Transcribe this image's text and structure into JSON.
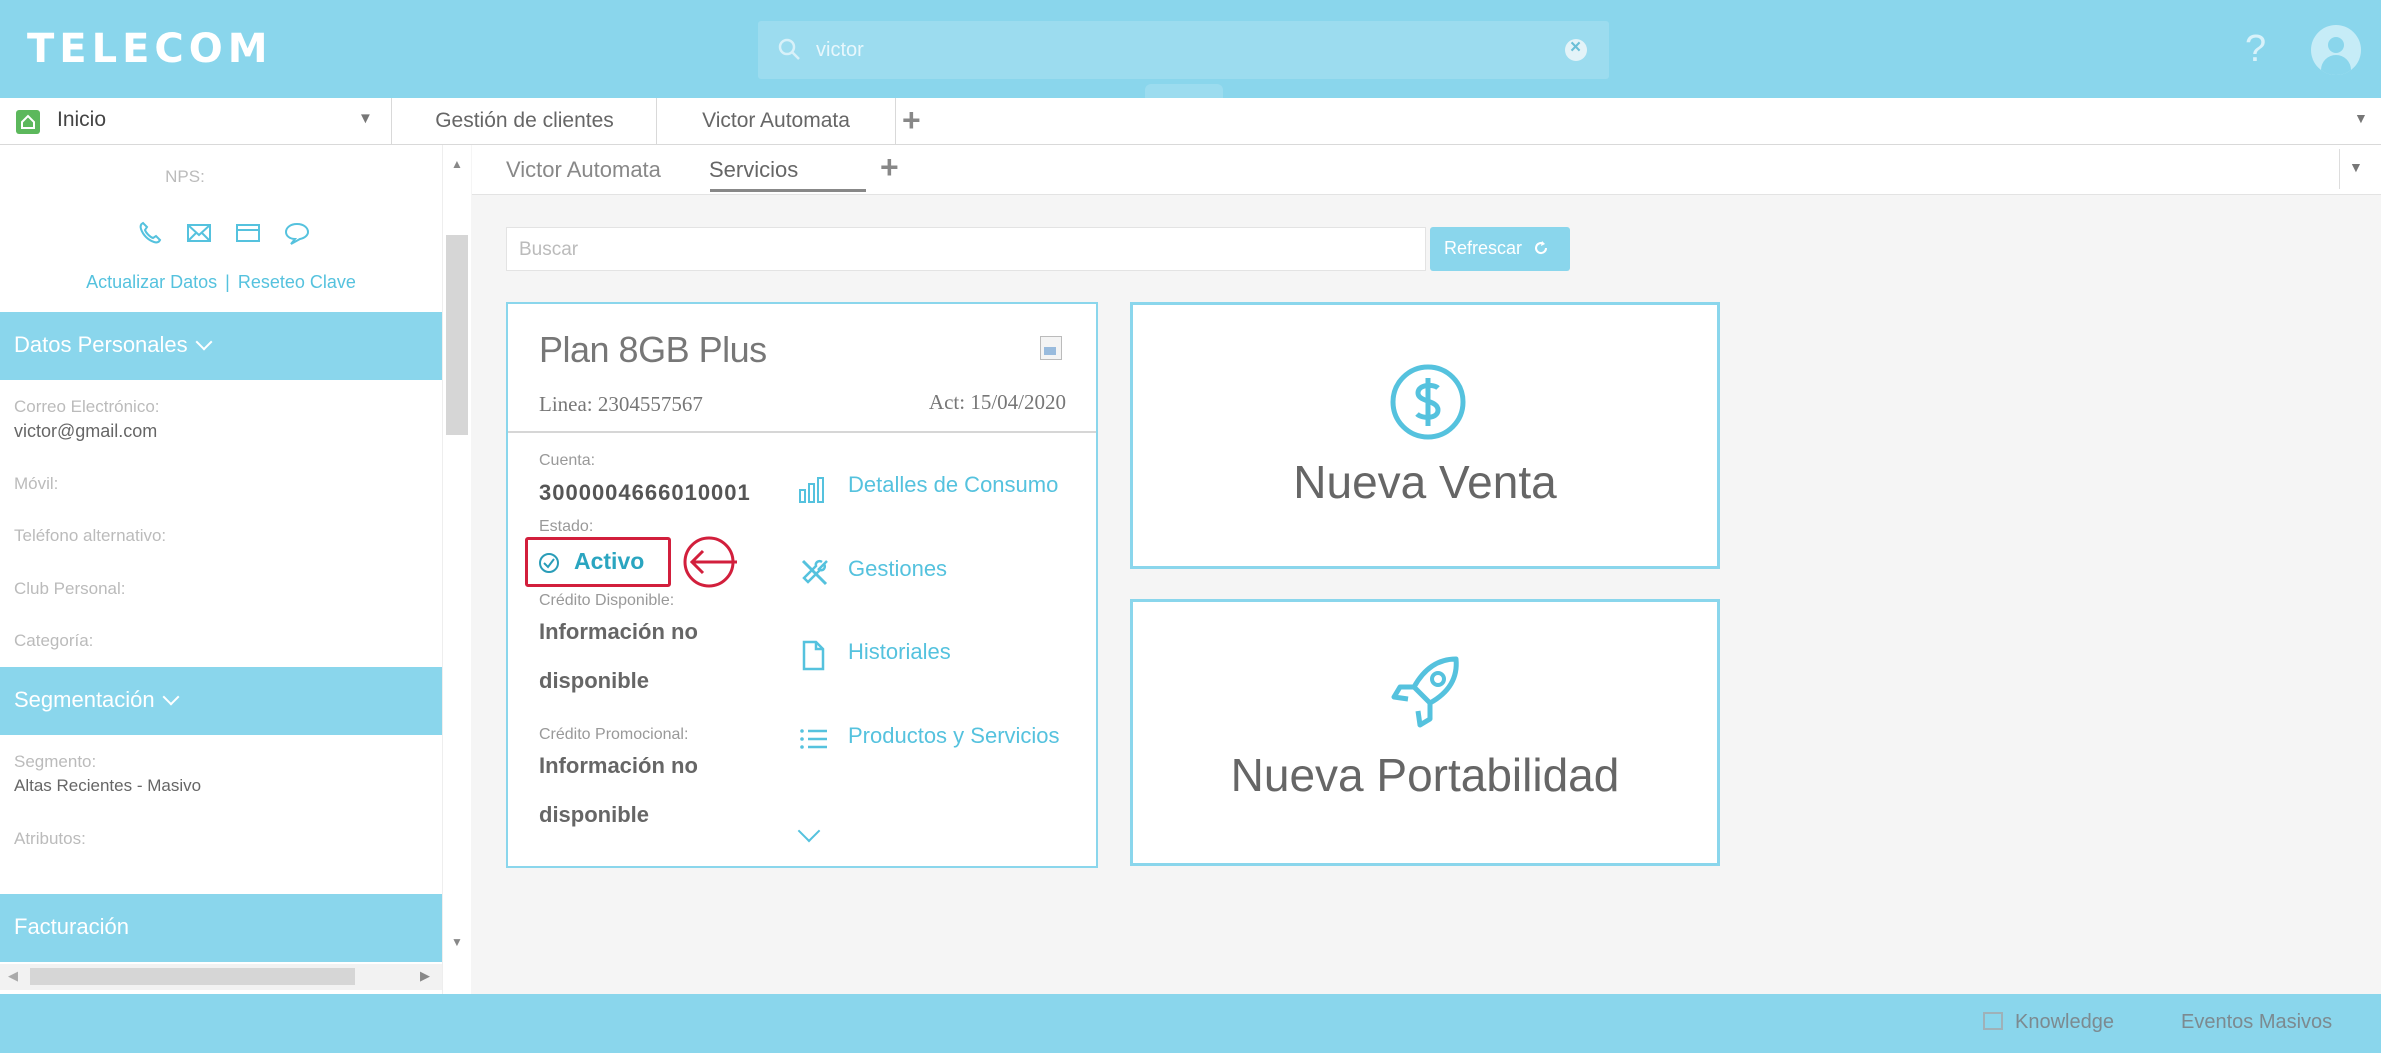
{
  "header": {
    "logo": "TELECOM",
    "search_value": "victor",
    "help_glyph": "?"
  },
  "tabs": {
    "home_label": "Inicio",
    "items": [
      {
        "label": "Gestión de clientes"
      },
      {
        "label": "Victor Automata"
      }
    ],
    "add_glyph": "+"
  },
  "sidebar": {
    "nps_label": "NPS:",
    "link_update": "Actualizar Datos",
    "link_separator": "|",
    "link_reset": "Reseteo Clave",
    "datos_personales": {
      "title": "Datos Personales",
      "correo_label": "Correo Electrónico:",
      "correo_value": "victor@gmail.com",
      "movil_label": "Móvil:",
      "telefono_label": "Teléfono alternativo:",
      "club_label": "Club Personal:",
      "categoria_label": "Categoría:"
    },
    "segmentacion": {
      "title": "Segmentación",
      "segmento_label": "Segmento:",
      "segmento_value": "Altas Recientes - Masivo",
      "atributos_label": "Atributos:"
    },
    "facturacion": {
      "title": "Facturación"
    }
  },
  "subtabs": {
    "items": [
      {
        "label": "Victor Automata"
      },
      {
        "label": "Servicios"
      }
    ],
    "add_glyph": "+"
  },
  "toolbar": {
    "search_placeholder": "Buscar",
    "refresh_label": "Refrescar"
  },
  "plan": {
    "name": "Plan 8GB Plus",
    "linea": "Linea: 2304557567",
    "act": "Act: 15/04/2020",
    "cuenta_label": "Cuenta:",
    "cuenta_value": "3000004666010001",
    "estado_label": "Estado:",
    "estado_value": "Activo",
    "credito_label": "Crédito Disponible:",
    "credito_value_1": "Información no",
    "credito_value_2": "disponible",
    "promo_label": "Crédito Promocional:",
    "promo_value_1": "Información no",
    "promo_value_2": "disponible",
    "actions": [
      {
        "label": "Detalles de Consumo",
        "icon": "bar-chart-icon"
      },
      {
        "label": "Gestiones",
        "icon": "tools-icon"
      },
      {
        "label": "Historiales",
        "icon": "document-icon"
      },
      {
        "label": "Productos y Servicios",
        "icon": "list-icon"
      }
    ]
  },
  "cards": {
    "nueva_venta": "Nueva Venta",
    "nueva_portabilidad": "Nueva Portabilidad"
  },
  "footer": {
    "knowledge": "Knowledge",
    "eventos": "Eventos Masivos"
  },
  "colors": {
    "brand": "#8ad6ec",
    "accent": "#55c2de",
    "status_active": "#2aa5c0",
    "highlight": "#d21f3c"
  }
}
